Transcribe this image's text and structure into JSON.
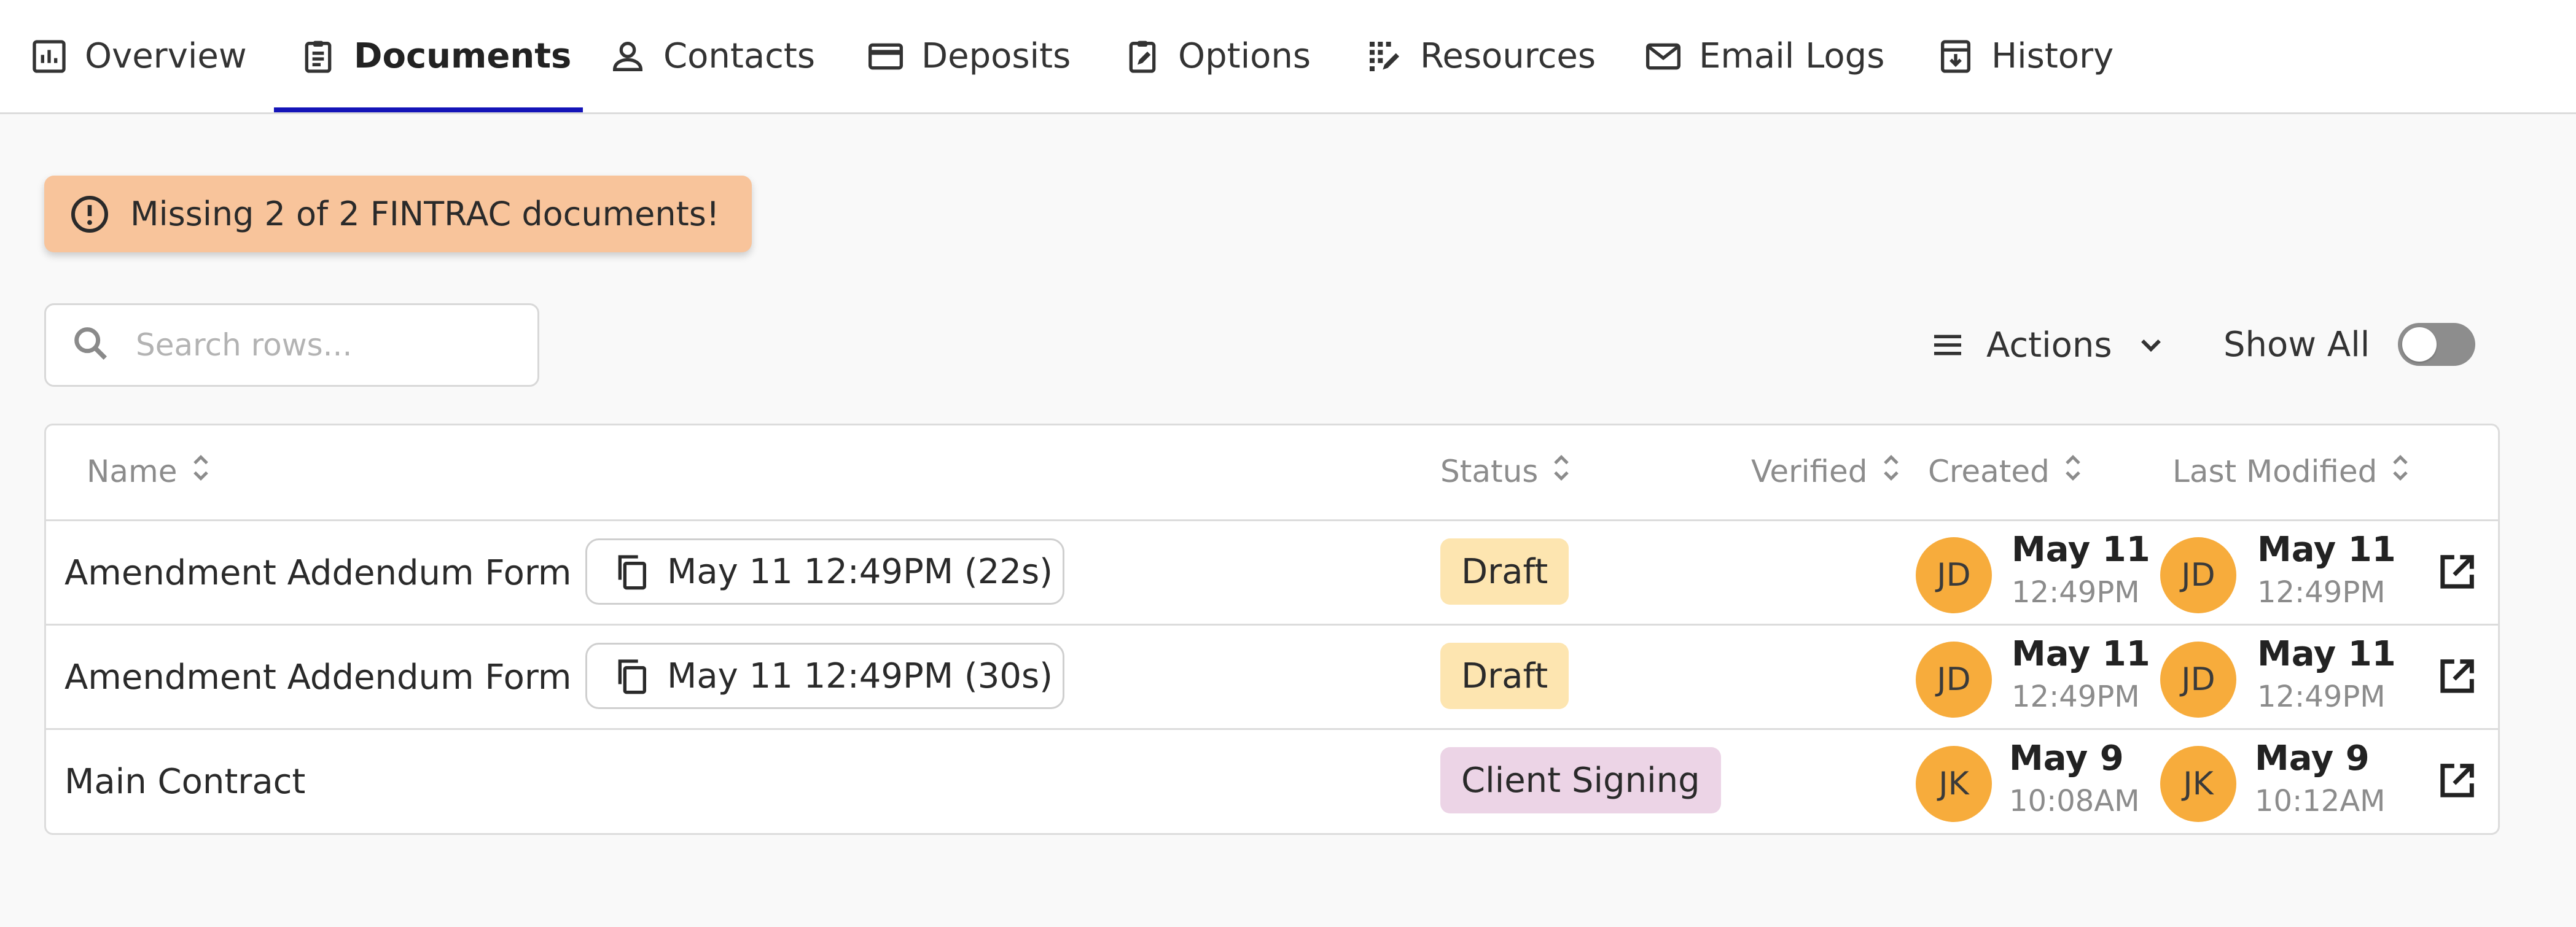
{
  "tabs": [
    {
      "label": "Overview",
      "icon": "bar-chart-icon"
    },
    {
      "label": "Documents",
      "icon": "clipboard-icon",
      "active": true
    },
    {
      "label": "Contacts",
      "icon": "person-icon"
    },
    {
      "label": "Deposits",
      "icon": "credit-card-icon"
    },
    {
      "label": "Options",
      "icon": "clipboard-edit-icon"
    },
    {
      "label": "Resources",
      "icon": "grid-edit-icon"
    },
    {
      "label": "Email Logs",
      "icon": "mail-icon"
    },
    {
      "label": "History",
      "icon": "archive-download-icon"
    }
  ],
  "alert": {
    "text": "Missing 2 of 2 FINTRAC documents!",
    "icon": "exclamation-circle-icon",
    "color": "#f8c49b"
  },
  "search": {
    "placeholder": "Search rows..."
  },
  "toolbar": {
    "actions_label": "Actions",
    "show_all_label": "Show All",
    "show_all_on": false
  },
  "table": {
    "columns": [
      "Name",
      "Status",
      "Verified",
      "Created",
      "Last Modified"
    ],
    "rows": [
      {
        "name": "Amendment Addendum Form",
        "version": "May 11 12:49PM (22s)",
        "status": "Draft",
        "status_color": "#fde5b0",
        "created_initials": "JD",
        "created_date": "May 11",
        "created_time": "12:49PM",
        "modified_initials": "JD",
        "modified_date": "May 11",
        "modified_time": "12:49PM"
      },
      {
        "name": "Amendment Addendum Form",
        "version": "May 11 12:49PM (30s)",
        "status": "Draft",
        "status_color": "#fde5b0",
        "created_initials": "JD",
        "created_date": "May 11",
        "created_time": "12:49PM",
        "modified_initials": "JD",
        "modified_date": "May 11",
        "modified_time": "12:49PM"
      },
      {
        "name": "Main Contract",
        "version": "",
        "status": "Client Signing",
        "status_color": "#ecd4e6",
        "created_initials": "JK",
        "created_date": "May 9",
        "created_time": "10:08AM",
        "modified_initials": "JK",
        "modified_date": "May 9",
        "modified_time": "10:12AM"
      }
    ]
  },
  "colors": {
    "accent": "#1414b8",
    "avatar": "#f7ac3c"
  }
}
